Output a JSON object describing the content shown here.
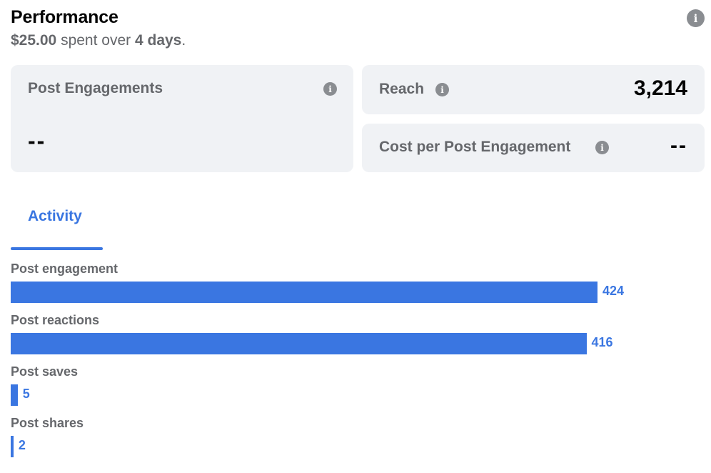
{
  "header": {
    "title": "Performance",
    "spent": "$25.00",
    "spent_text": "spent over",
    "duration": "4 days",
    "period": "."
  },
  "cards": {
    "post_engagements": {
      "label": "Post Engagements",
      "value": "--"
    },
    "reach": {
      "label": "Reach",
      "value": "3,214"
    },
    "cost_per_engagement": {
      "label": "Cost per Post Engagement",
      "value": "--"
    }
  },
  "tabs": [
    {
      "label": "Activity",
      "active": true
    }
  ],
  "colors": {
    "accent": "#3a76e1",
    "card_bg": "#f0f2f5",
    "muted_text": "#65676b"
  },
  "icons": {
    "info": "info-icon"
  },
  "chart_data": {
    "type": "bar",
    "categories": [
      "Post engagement",
      "Post reactions",
      "Post saves",
      "Post shares"
    ],
    "values": [
      424,
      416,
      5,
      2
    ],
    "value_labels": [
      "424",
      "416",
      "5",
      "2"
    ]
  }
}
